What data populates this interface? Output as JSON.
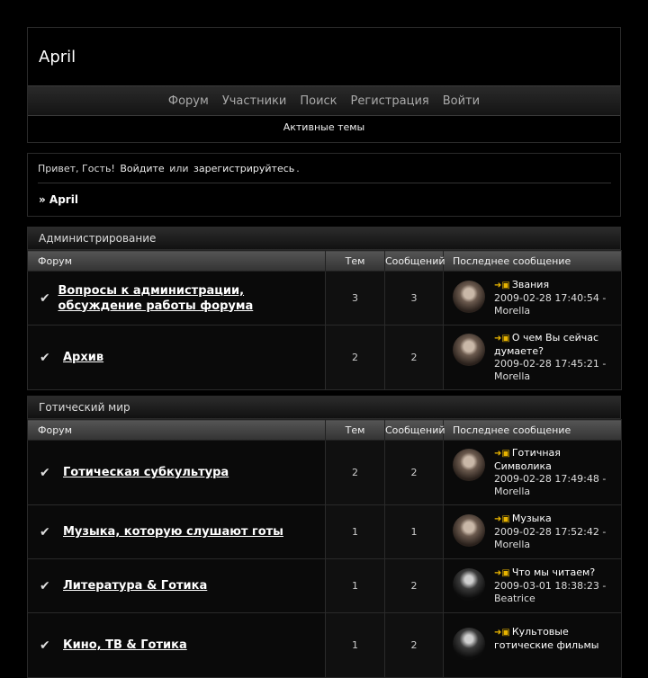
{
  "site": {
    "title": "April"
  },
  "nav": {
    "items": [
      "Форум",
      "Участники",
      "Поиск",
      "Регистрация",
      "Войти"
    ],
    "active_topics": "Активные темы"
  },
  "welcome": {
    "hello": "Привет, Гость!",
    "login": "Войдите",
    "or": "или",
    "register": "зарегистрируйтесь",
    "dot": ".",
    "breadcrumb": "» April"
  },
  "headers": {
    "forum": "Форум",
    "topics": "Тем",
    "posts": "Сообщений",
    "last": "Последнее сообщение"
  },
  "categories": [
    {
      "title": "Администрирование",
      "forums": [
        {
          "name": "Вопросы к администрации, обсуждение работы форума",
          "topics": "3",
          "posts": "3",
          "last_title": "Звания",
          "last_date": "2009-02-28 17:40:54 -",
          "last_user": "Morella"
        },
        {
          "name": "Архив",
          "topics": "2",
          "posts": "2",
          "last_title": "О чем Вы сейчас думаете?",
          "last_date": "2009-02-28 17:45:21 -",
          "last_user": "Morella"
        }
      ]
    },
    {
      "title": "Готический мир",
      "forums": [
        {
          "name": "Готическая субкультура",
          "topics": "2",
          "posts": "2",
          "last_title": "Готичная Символика",
          "last_date": "2009-02-28 17:49:48 -",
          "last_user": "Morella"
        },
        {
          "name": "Музыка, которую слушают готы",
          "topics": "1",
          "posts": "1",
          "last_title": "Музыка",
          "last_date": "2009-02-28 17:52:42 -",
          "last_user": "Morella"
        },
        {
          "name": "Литература & Готика",
          "topics": "1",
          "posts": "2",
          "last_title": "Что мы читаем?",
          "last_date": "2009-03-01 18:38:23 -",
          "last_user": "Beatrice"
        },
        {
          "name": "Кино, ТВ & Готика",
          "topics": "1",
          "posts": "2",
          "last_title": "Культовые готические фильмы",
          "last_date": "",
          "last_user": ""
        }
      ]
    }
  ]
}
